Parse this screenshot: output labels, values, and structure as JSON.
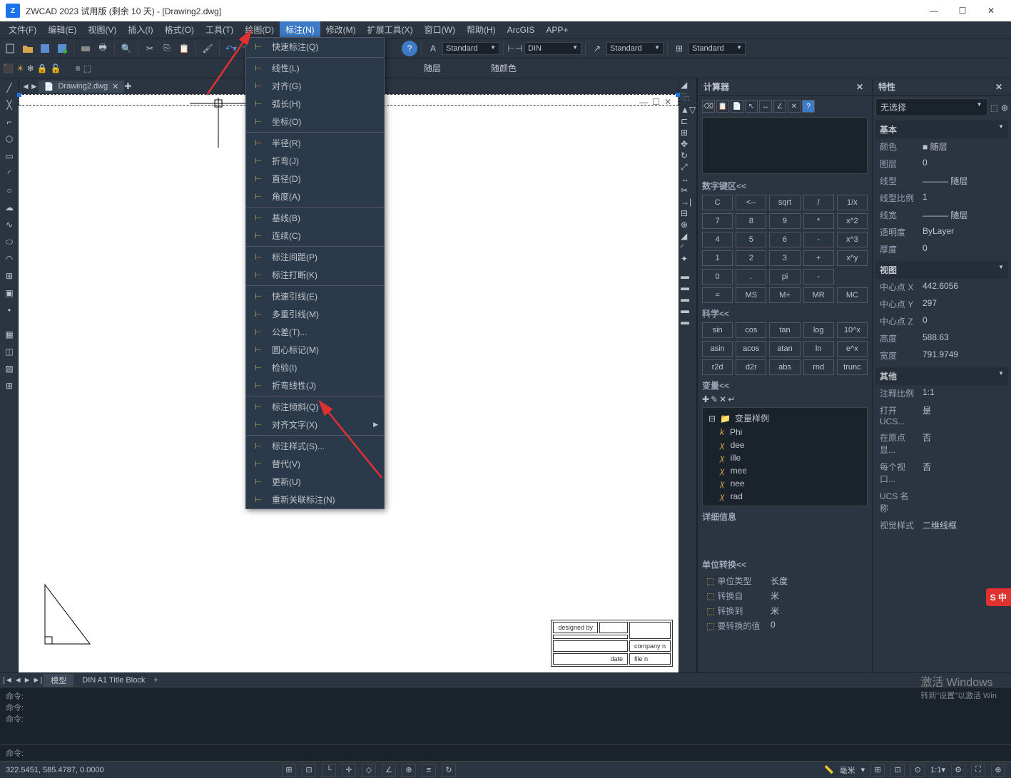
{
  "window": {
    "title": "ZWCAD 2023 试用版 (剩余 10 天) - [Drawing2.dwg]",
    "min": "—",
    "max": "☐",
    "close": "✕"
  },
  "menubar": [
    "文件(F)",
    "编辑(E)",
    "视图(V)",
    "插入(I)",
    "格式(O)",
    "工具(T)",
    "绘图(D)",
    "标注(N)",
    "修改(M)",
    "扩展工具(X)",
    "窗口(W)",
    "帮助(H)",
    "ArcGIS",
    "APP+"
  ],
  "active_menu_index": 7,
  "dropdown": {
    "items": [
      {
        "label": "快速标注(Q)"
      },
      {
        "sep": true
      },
      {
        "label": "线性(L)"
      },
      {
        "label": "对齐(G)"
      },
      {
        "label": "弧长(H)"
      },
      {
        "label": "坐标(O)"
      },
      {
        "sep": true
      },
      {
        "label": "半径(R)"
      },
      {
        "label": "折弯(J)"
      },
      {
        "label": "直径(D)"
      },
      {
        "label": "角度(A)"
      },
      {
        "sep": true
      },
      {
        "label": "基线(B)"
      },
      {
        "label": "连续(C)"
      },
      {
        "sep": true
      },
      {
        "label": "标注间距(P)"
      },
      {
        "label": "标注打断(K)"
      },
      {
        "sep": true
      },
      {
        "label": "快速引线(E)"
      },
      {
        "label": "多重引线(M)"
      },
      {
        "label": "公差(T)..."
      },
      {
        "label": "圆心标记(M)"
      },
      {
        "label": "检验(I)"
      },
      {
        "label": "折弯线性(J)"
      },
      {
        "sep": true
      },
      {
        "label": "标注倾斜(Q)"
      },
      {
        "label": "对齐文字(X)",
        "submenu": true
      },
      {
        "sep": true
      },
      {
        "label": "标注样式(S)..."
      },
      {
        "label": "替代(V)"
      },
      {
        "label": "更新(U)"
      },
      {
        "label": "重新关联标注(N)"
      }
    ]
  },
  "toolbar_combos": {
    "standard1": "Standard",
    "din": "DIN",
    "standard2": "Standard",
    "standard3": "Standard",
    "layer1": "随层",
    "layer2": "随层",
    "color": "随颜色"
  },
  "tabs": {
    "file": "Drawing2.dwg"
  },
  "bottom_tabs": [
    "模型",
    "DIN A1 Title Block"
  ],
  "command": {
    "history": [
      "命令:",
      "命令:",
      "命令:"
    ],
    "prompt": "命令:"
  },
  "statusbar": {
    "coords": "322.5451, 585.4787, 0.0000",
    "unit_label": "毫米"
  },
  "calculator": {
    "title": "计算器",
    "numpad_header": "数字键区<<",
    "numpad": [
      [
        "C",
        "<--",
        "sqrt",
        "/",
        "1/x"
      ],
      [
        "7",
        "8",
        "9",
        "*",
        "x^2"
      ],
      [
        "4",
        "5",
        "6",
        "-",
        "x^3"
      ],
      [
        "1",
        "2",
        "3",
        "+",
        "x^y"
      ],
      [
        "0",
        ".",
        "pi",
        "-",
        ""
      ],
      [
        "=",
        "MS",
        "M+",
        "MR",
        "MC"
      ]
    ],
    "sci_header": "科学<<",
    "sci": [
      [
        "sin",
        "cos",
        "tan",
        "log",
        "10^x"
      ],
      [
        "asin",
        "acos",
        "atan",
        "ln",
        "e^x"
      ],
      [
        "r2d",
        "d2r",
        "abs",
        "rnd",
        "trunc"
      ]
    ],
    "var_header": "变量<<",
    "var_folder": "变量样例",
    "vars": [
      "Phi",
      "dee",
      "ille",
      "mee",
      "nee",
      "rad"
    ],
    "detail_header": "详细信息",
    "unit_header": "单位转换<<",
    "unit_rows": [
      {
        "label": "单位类型",
        "value": "长度"
      },
      {
        "label": "转换自",
        "value": "米"
      },
      {
        "label": "转换到",
        "value": "米"
      },
      {
        "label": "要转换的值",
        "value": "0"
      }
    ]
  },
  "properties": {
    "title": "特性",
    "selection": "无选择",
    "sections": {
      "basic": {
        "title": "基本",
        "rows": [
          {
            "label": "颜色",
            "value": "■ 随层"
          },
          {
            "label": "图层",
            "value": "0"
          },
          {
            "label": "线型",
            "value": "——— 随层"
          },
          {
            "label": "线型比例",
            "value": "1"
          },
          {
            "label": "线宽",
            "value": "——— 随层"
          },
          {
            "label": "透明度",
            "value": "ByLayer"
          },
          {
            "label": "厚度",
            "value": "0"
          }
        ]
      },
      "view": {
        "title": "视图",
        "rows": [
          {
            "label": "中心点 X",
            "value": "442.6056"
          },
          {
            "label": "中心点 Y",
            "value": "297"
          },
          {
            "label": "中心点 Z",
            "value": "0"
          },
          {
            "label": "高度",
            "value": "588.63"
          },
          {
            "label": "宽度",
            "value": "791.9749"
          }
        ]
      },
      "other": {
        "title": "其他",
        "rows": [
          {
            "label": "注释比例",
            "value": "1:1"
          },
          {
            "label": "打开 UCS...",
            "value": "是"
          },
          {
            "label": "在原点显...",
            "value": "否"
          },
          {
            "label": "每个视口...",
            "value": "否"
          },
          {
            "label": "UCS 名称",
            "value": ""
          },
          {
            "label": "视觉样式",
            "value": "二维线框"
          }
        ]
      }
    }
  },
  "title_block": {
    "designed_by": "designed by",
    "company": "company n",
    "date": "date",
    "file": "file n"
  },
  "watermark": {
    "line1": "激活 Windows",
    "line2": "转到\"设置\"以激活 Win"
  }
}
